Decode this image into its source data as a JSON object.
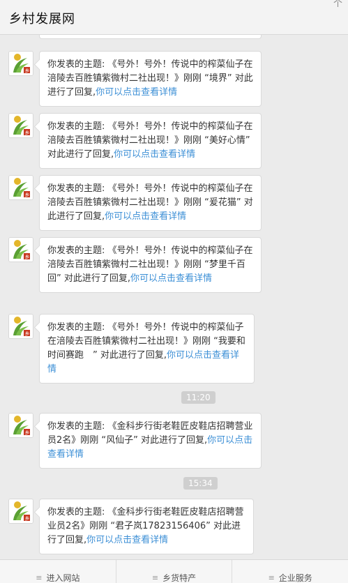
{
  "header": {
    "title": "乡村发展网",
    "corner_glyph": "个"
  },
  "messages": [
    {
      "prefix": "你发表的主题: 《号外！号外！传说中的榨菜仙子在涪陵去百胜镇紫微村二社出现！》刚刚 “境界” 对此进行了回复,",
      "link": "你可以点击查看详情"
    },
    {
      "prefix": "你发表的主题: 《号外！号外！传说中的榨菜仙子在涪陵去百胜镇紫微村二社出现！》刚刚 “美好心情” 对此进行了回复,",
      "link": "你可以点击查看详情"
    },
    {
      "prefix": "你发表的主题: 《号外！号外！传说中的榨菜仙子在涪陵去百胜镇紫微村二社出现！》刚刚 “爰花猫” 对此进行了回复,",
      "link": "你可以点击查看详情"
    },
    {
      "prefix": "你发表的主题: 《号外！号外！传说中的榨菜仙子在涪陵去百胜镇紫微村二社出现！》刚刚 “梦里千百回” 对此进行了回复,",
      "link": "你可以点击查看详情"
    },
    {
      "prefix": "你发表的主题: 《号外！号外！传说中的榨菜仙子在涪陵去百胜镇紫微村二社出现！》刚刚 “我要和时间赛跑　” 对此进行了回复,",
      "link": "你可以点击查看详情"
    },
    {
      "prefix": "你发表的主题: 《金科步行街老鞋匠皮鞋店招聘营业员2名》刚刚 “风仙子” 对此进行了回复,",
      "link": "你可以点击查看详情"
    },
    {
      "prefix": "你发表的主题: 《金科步行街老鞋匠皮鞋店招聘营业员2名》刚刚 “君子岚17823156406” 对此进行了回复,",
      "link": "你可以点击查看详情"
    }
  ],
  "timestamps": [
    "11:20",
    "15:34"
  ],
  "footer": {
    "menu_icon": "≡",
    "tabs": [
      "进入网站",
      "乡货特产",
      "企业服务"
    ]
  },
  "avatar_icon": "village-logo-icon",
  "colors": {
    "link": "#3c8fd6",
    "header_bg": "#f3f3f3",
    "feed_bg": "#ebebeb",
    "time_badge": "#cfcfcf"
  }
}
